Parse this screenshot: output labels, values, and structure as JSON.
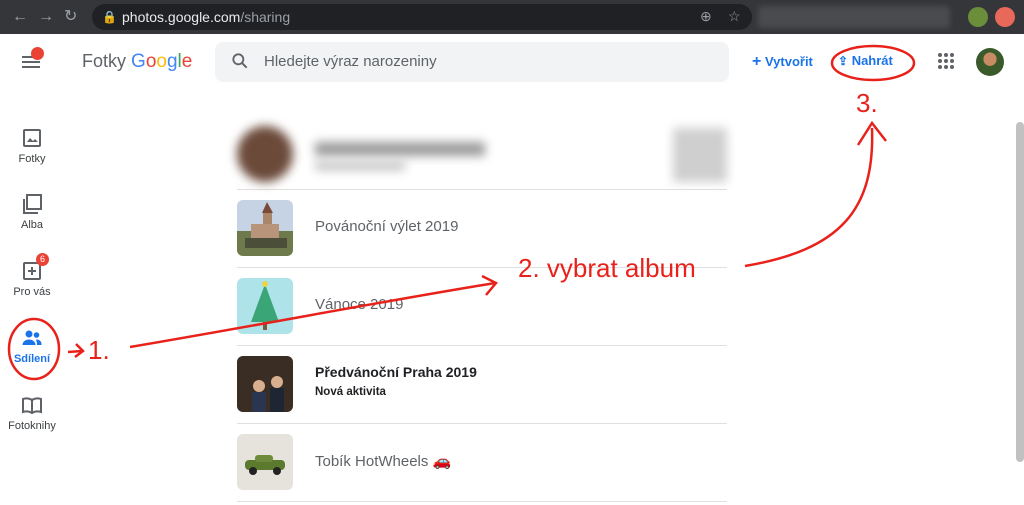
{
  "browser": {
    "url_host": "photos.google.com",
    "url_path": "/sharing"
  },
  "header": {
    "logo_prefix": "Fotky",
    "logo_brand": "Google",
    "search_placeholder": "Hledejte výraz narozeniny",
    "create_label": "Vytvořit",
    "upload_label": "Nahrát"
  },
  "sidebar": {
    "items": [
      {
        "label": "Fotky"
      },
      {
        "label": "Alba"
      },
      {
        "label": "Pro vás",
        "badge": "6"
      },
      {
        "label": "Sdílení"
      },
      {
        "label": "Fotoknihy"
      }
    ]
  },
  "albums": [
    {
      "title": "Povánoční výlet 2019"
    },
    {
      "title": "Vánoce 2019"
    },
    {
      "title": "Předvánoční Praha 2019",
      "subtitle": "Nová aktivita"
    },
    {
      "title": "Tobík HotWheels 🚗"
    }
  ],
  "annotations": {
    "step1": "1.",
    "step2": "2. vybrat album",
    "step3": "3."
  },
  "colors": {
    "accent": "#1a73e8",
    "annotation": "#e8221b"
  }
}
